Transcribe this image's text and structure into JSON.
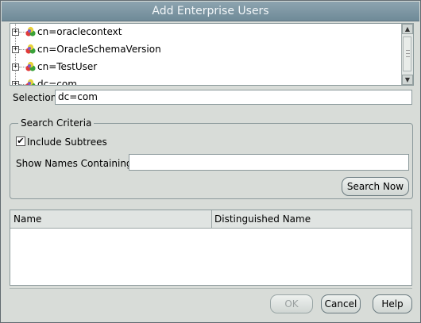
{
  "window": {
    "title": "Add Enterprise Users"
  },
  "tree": {
    "items": [
      {
        "label": "cn=oraclecontext",
        "expander": "+"
      },
      {
        "label": "cn=OracleSchemaVersion",
        "expander": "+"
      },
      {
        "label": "cn=TestUser",
        "expander": "+"
      },
      {
        "label": "dc=com",
        "expander": "+"
      }
    ]
  },
  "selection": {
    "label": "Selection",
    "value": "dc=com"
  },
  "search_criteria": {
    "legend": "Search Criteria",
    "include_subtrees": {
      "label": "Include Subtrees",
      "checked": true,
      "mark": "✔"
    },
    "names_label": "Show Names Containing:",
    "names_value": "",
    "search_button": "Search Now"
  },
  "results_table": {
    "columns": [
      "Name",
      "Distinguished Name"
    ],
    "rows": []
  },
  "footer": {
    "ok_label": "OK",
    "cancel_label": "Cancel",
    "help_label": "Help"
  }
}
